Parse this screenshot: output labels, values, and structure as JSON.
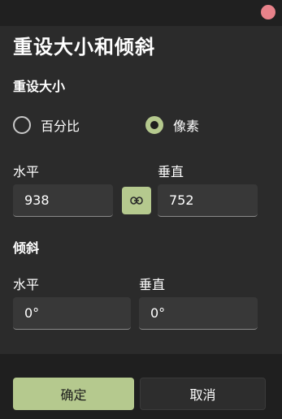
{
  "dialog": {
    "title": "重设大小和倾斜"
  },
  "resize": {
    "section_title": "重设大小",
    "options": [
      {
        "label": "百分比",
        "selected": false
      },
      {
        "label": "像素",
        "selected": true
      }
    ],
    "horizontal_label": "水平",
    "vertical_label": "垂直",
    "horizontal_value": "938",
    "vertical_value": "752",
    "aspect_lock": true
  },
  "skew": {
    "section_title": "倾斜",
    "horizontal_label": "水平",
    "vertical_label": "垂直",
    "horizontal_value": "0°",
    "vertical_value": "0°"
  },
  "buttons": {
    "ok_label": "确定",
    "cancel_label": "取消"
  },
  "colors": {
    "accent": "#b5c98e",
    "close": "#e8828a",
    "background": "#2b2b2b",
    "input": "#383838"
  },
  "icons": {
    "close": "close-icon",
    "link": "link-icon"
  }
}
